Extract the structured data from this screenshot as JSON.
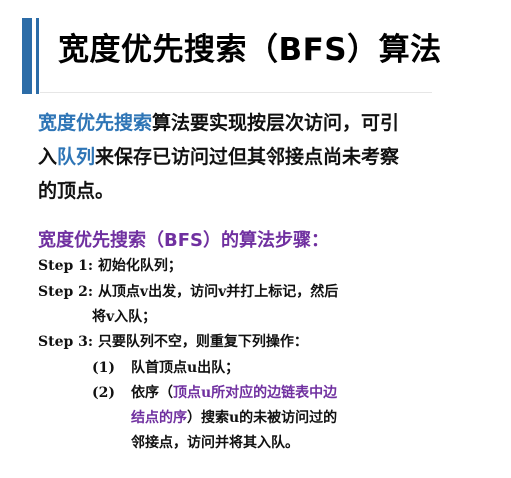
{
  "title": "宽度优先搜索（BFS）算法",
  "intro": {
    "line1_prefix": "宽度优先搜索",
    "line1_rest": "算法要实现按层次访问，可引",
    "line2_prefix": "入",
    "line2_queue": "队列",
    "line2_rest": "来保存已访问过但其邻接点尚未考察",
    "line3": "的顶点。"
  },
  "subhead": "宽度优先搜索（BFS）的算法步骤：",
  "steps": [
    {
      "label": "Step 1:",
      "text": "初始化队列；"
    },
    {
      "label": "Step 2:",
      "text": "从顶点v出发，访问v并打上标记，然后",
      "continuation": "将v入队；"
    },
    {
      "label": "Step 3:",
      "text": "只要队列不空，则重复下列操作："
    }
  ],
  "substeps": [
    {
      "num": "(1)",
      "text": "队首顶点u出队；"
    },
    {
      "num": "(2)",
      "prefix": "依序（",
      "highlight_line1": "顶点u所对应的边链表中边",
      "highlight_line2": "结点的序",
      "suffix_line2": "）搜索u的未被访问过的",
      "line3": "邻接点，访问并将其入队。"
    }
  ],
  "colors": {
    "accent_bar": "#2c6ca7",
    "blue_text": "#2e75b6",
    "purple_text": "#7030a0",
    "body_text": "#111111"
  }
}
